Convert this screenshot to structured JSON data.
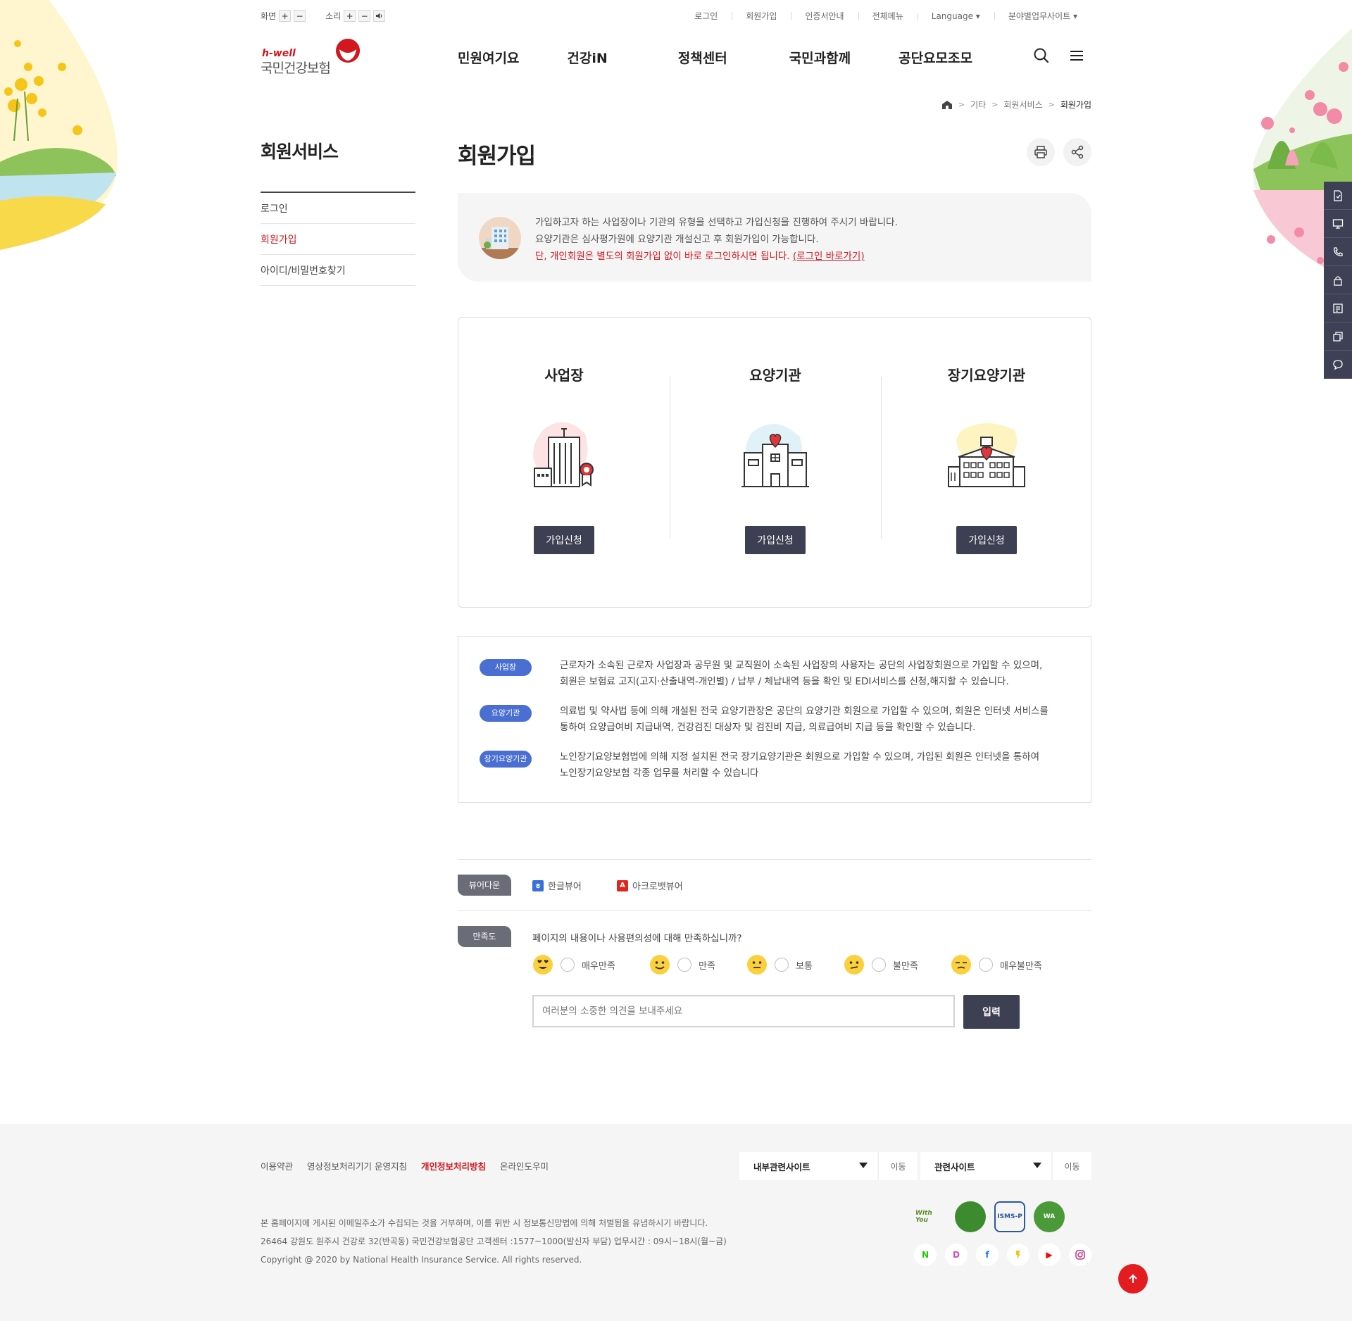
{
  "util": {
    "screen_label": "화면",
    "sound_label": "소리",
    "plus": "+",
    "minus": "−",
    "links": [
      "로그인",
      "회원가입",
      "인증서안내",
      "전체메뉴",
      "Language ▾"
    ],
    "work_sites": "분야별업무사이트 ▾"
  },
  "logo": {
    "brand": "h-well",
    "name": "국민건강보험"
  },
  "gnb": [
    "민원여기요",
    "건강iN",
    "정책센터",
    "국민과함께",
    "공단요모조모"
  ],
  "breadcrumb": [
    "기타",
    "회원서비스",
    "회원가입"
  ],
  "lnb": {
    "title": "회원서비스",
    "items": [
      "로그인",
      "회원가입",
      "아이디/비밀번호찾기"
    ]
  },
  "page": {
    "title": "회원가입",
    "intro_line1": "가입하고자 하는 사업장이나 기관의 유형을 선택하고 가입신청을 진행하여 주시기 바랍니다.",
    "intro_line2": "요양기관은 심사평가원에 요양기관 개설신고 후 회원가입이 가능합니다.",
    "intro_line3": "단, 개인회원은 별도의 회원가입 없이 바로 로그인하시면 됩니다. ",
    "intro_link": "(로그인 바로가기)"
  },
  "types": [
    {
      "title": "사업장",
      "button": "가입신청"
    },
    {
      "title": "요양기관",
      "button": "가입신청"
    },
    {
      "title": "장기요양기관",
      "button": "가입신청"
    }
  ],
  "descriptions": [
    {
      "badge": "사업장",
      "line1": "근로자가 소속된 근로자 사업장과 공무원 및 교직원이 소속된 사업장의 사용자는 공단의 사업장회원으로 가입할 수 있으며,",
      "line2": "회원은 보험료 고지(고지·산출내역-개인별) / 납부 / 체납내역 등을 확인 및 EDI서비스를 신청,해지할 수 있습니다."
    },
    {
      "badge": "요양기관",
      "line1": "의료법 및 약사법 등에 의해 개설된 전국 요양기관장은 공단의 요양기관 회원으로 가입할 수 있으며, 회원은 인터넷 서비스를",
      "line2": "통하여 요양급여비 지급내역, 건강검진 대상자 및 검진비 지급, 의료급여비 지급 등을 확인할 수 있습니다."
    },
    {
      "badge": "장기요양기관",
      "line1": "노인장기요양보험법에 의해 지정 설치된 전국 장기요양기관은 회원으로 가입할 수 있으며, 가입된 회원은 인터넷을 통하여",
      "line2": "노인장기요양보험 각종 업무를 처리할 수 있습니다"
    }
  ],
  "viewer": {
    "tag": "뷰어다운",
    "hwp": "한글뷰어",
    "acrobat": "아크로뱃뷰어"
  },
  "satisfaction": {
    "tag": "만족도",
    "question": "페이지의 내용이나 사용편의성에 대해 만족하십니까?",
    "options": [
      "매우만족",
      "만족",
      "보통",
      "불만족",
      "매우불만족"
    ],
    "placeholder": "여러분의 소중한 의견을 보내주세요",
    "submit": "입력"
  },
  "footer": {
    "links": [
      "이용약관",
      "영상정보처리기기 운영지침",
      "개인정보처리방침",
      "온라인도우미"
    ],
    "select1": "내부관련사이트",
    "select2": "관련사이트",
    "go": "이동",
    "notice": "본 홈페이지에 게시된 이메일주소가 수집되는 것을 거부하며, 이를 위반 시 정보통신망법에 의해 처벌됨을 유념하시기 바랍니다.",
    "address": "26464 강원도 원주시 건강로 32(반곡동) 국민건강보험공단 고객센터 :1577~1000(발신자 부담) 업무시간 : 09시~18시(월~금)",
    "copyright": "Copyright @ 2020 by National Health Insurance Service. All rights reserved.",
    "certs": [
      "With You",
      "",
      "ISMS-P",
      "WA"
    ],
    "sns": [
      "N",
      "D",
      "f",
      "",
      "▶",
      ""
    ]
  },
  "colors": {
    "accent": "#d2171e",
    "dark_button": "#3d3f52",
    "badge": "#4a6fd3"
  }
}
